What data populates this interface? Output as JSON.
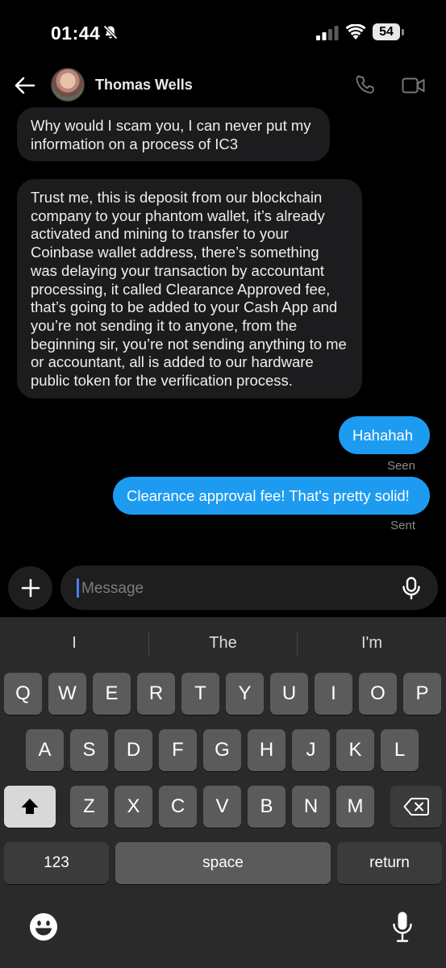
{
  "status_bar": {
    "time": "01:44",
    "battery": "54"
  },
  "header": {
    "contact_name": "Thomas Wells"
  },
  "messages": [
    {
      "direction": "incoming",
      "text": "Why would I scam you, I can never put my information on a process of IC3"
    },
    {
      "direction": "incoming",
      "text": "Trust me, this is deposit from our blockchain company to your phantom wallet, it’s already activated and mining to transfer to your Coinbase wallet address, there’s something was delaying your transaction by accountant processing, it called Clearance Approved fee, that’s going to be added to your Cash App and you’re not sending it to anyone, from the beginning sir, you’re not sending anything to me or accountant, all is added to our hardware public token for the verification process."
    },
    {
      "direction": "outgoing",
      "text": "Hahahah",
      "receipt": "Seen"
    },
    {
      "direction": "outgoing",
      "text": "Clearance approval fee! That's pretty solid!",
      "receipt": "Sent"
    }
  ],
  "composer": {
    "placeholder": "Message"
  },
  "keyboard": {
    "suggestions": [
      "I",
      "The",
      "I'm"
    ],
    "row1": [
      "Q",
      "W",
      "E",
      "R",
      "T",
      "Y",
      "U",
      "I",
      "O",
      "P"
    ],
    "row2": [
      "A",
      "S",
      "D",
      "F",
      "G",
      "H",
      "J",
      "K",
      "L"
    ],
    "row3": [
      "Z",
      "X",
      "C",
      "V",
      "B",
      "N",
      "M"
    ],
    "numbers_key": "123",
    "space_key": "space",
    "return_key": "return"
  },
  "colors": {
    "outgoing_bubble": "#1d9bf0",
    "incoming_bubble": "#1c1c1e",
    "background": "#000000",
    "keyboard": "#2a2a2a"
  },
  "icons": [
    "bell-slash-icon",
    "signal-icon",
    "wifi-icon",
    "battery-icon",
    "back-arrow-icon",
    "phone-icon",
    "video-icon",
    "plus-icon",
    "microphone-icon",
    "shift-icon",
    "backspace-icon",
    "emoji-icon"
  ]
}
